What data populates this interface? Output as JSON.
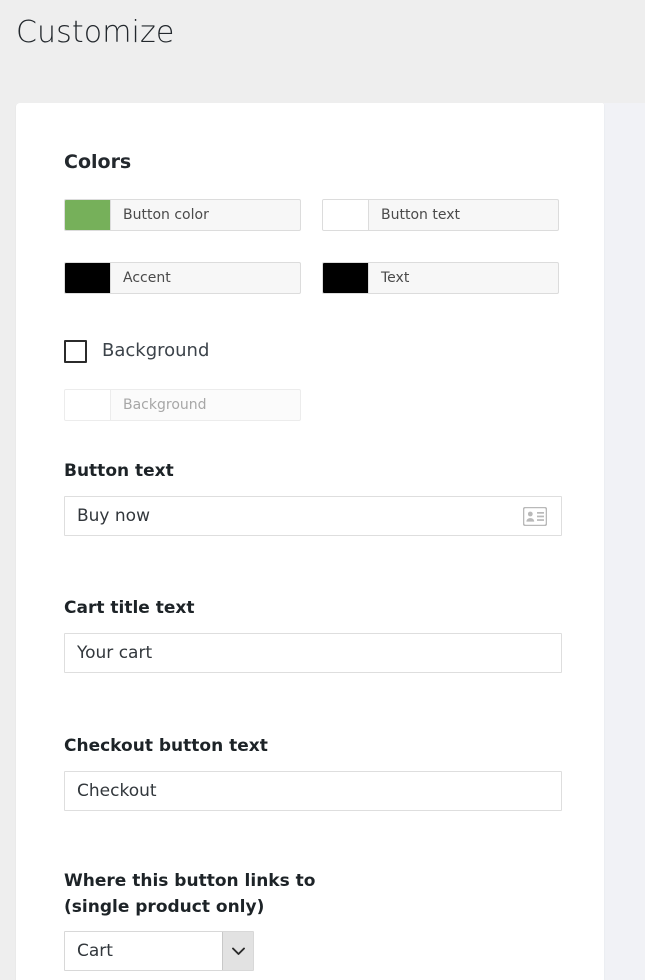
{
  "page": {
    "title": "Customize"
  },
  "colors": {
    "heading": "Colors",
    "fields": [
      {
        "label": "Button color",
        "swatch": "#76b05a",
        "name": "button-color"
      },
      {
        "label": "Button text",
        "swatch": "#ffffff",
        "name": "button-text-color"
      },
      {
        "label": "Accent",
        "swatch": "#000000",
        "name": "accent-color"
      },
      {
        "label": "Text",
        "swatch": "#000000",
        "name": "text-color"
      }
    ],
    "background_toggle": {
      "label": "Background",
      "checked": false
    },
    "background_field": {
      "label": "Background",
      "swatch": "#ffffff",
      "disabled": true
    }
  },
  "fields": {
    "button_text": {
      "label": "Button text",
      "value": "Buy now",
      "icon": "id-card-icon"
    },
    "cart_title_text": {
      "label": "Cart title text",
      "value": "Your cart"
    },
    "checkout_button_text": {
      "label": "Checkout button text",
      "value": "Checkout"
    },
    "button_link": {
      "label_line1": "Where this button links to",
      "label_line2": "(single product only)",
      "value": "Cart",
      "options": [
        "Cart"
      ]
    }
  }
}
